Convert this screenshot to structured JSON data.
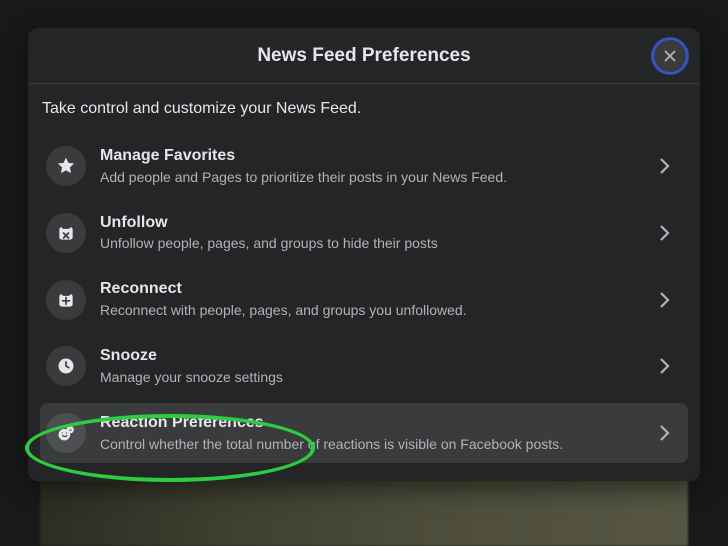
{
  "modal": {
    "title": "News Feed Preferences",
    "subtitle": "Take control and customize your News Feed."
  },
  "items": [
    {
      "icon": "star",
      "title": "Manage Favorites",
      "desc": "Add people and Pages to prioritize their posts in your News Feed.",
      "highlighted": false
    },
    {
      "icon": "unfollow",
      "title": "Unfollow",
      "desc": "Unfollow people, pages, and groups to hide their posts",
      "highlighted": false
    },
    {
      "icon": "reconnect",
      "title": "Reconnect",
      "desc": "Reconnect with people, pages, and groups you unfollowed.",
      "highlighted": false
    },
    {
      "icon": "clock",
      "title": "Snooze",
      "desc": "Manage your snooze settings",
      "highlighted": false
    },
    {
      "icon": "reaction",
      "title": "Reaction Preferences",
      "desc": "Control whether the total number of reactions is visible on Facebook posts.",
      "highlighted": true
    }
  ],
  "annotation": {
    "ellipse_on_item_index": 4
  }
}
